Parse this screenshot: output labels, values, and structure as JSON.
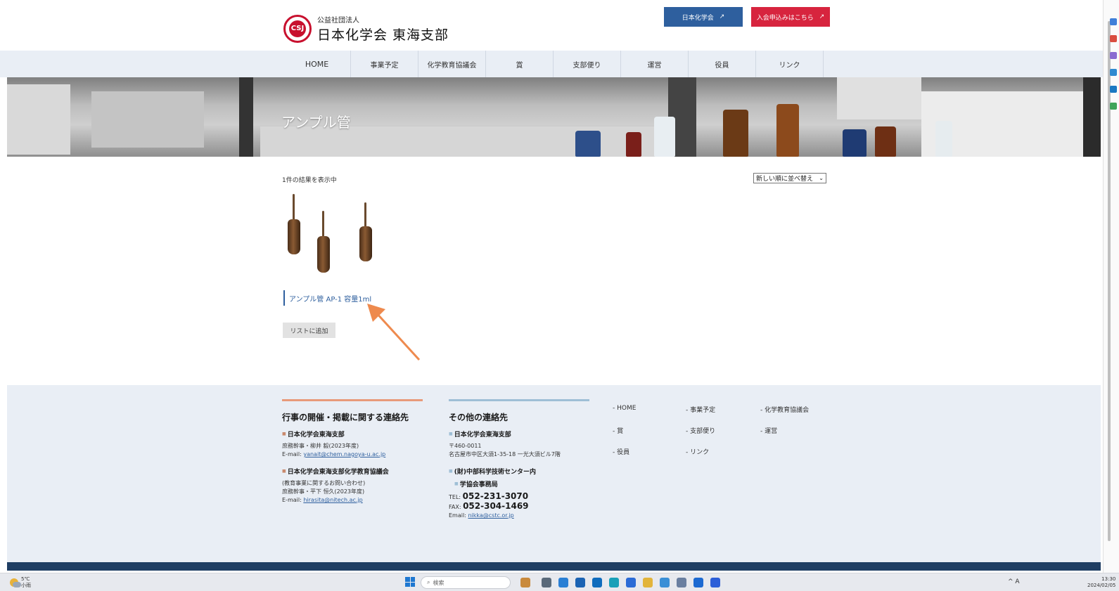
{
  "header": {
    "org_prefix": "公益社団法人",
    "org_name": "日本化学会 東海支部",
    "logo_mark": "CSJ",
    "btn_csj": "日本化学会",
    "btn_join": "入会申込みはこちら",
    "ext_icon": "external-link-icon"
  },
  "nav": {
    "items": [
      "HOME",
      "事業予定",
      "化学教育協議会",
      "賞",
      "支部便り",
      "運営",
      "役員",
      "リンク"
    ]
  },
  "hero": {
    "title": "アンプル管"
  },
  "shop": {
    "result_count": "1件の結果を表示中",
    "sort_label": "新しい順に並べ替え",
    "product_name": "アンプル管 AP-1 容量1ml",
    "add_to_list": "リストに追加"
  },
  "footer": {
    "col1": {
      "heading": "行事の開催・掲載に関する連絡先",
      "block1_title": "日本化学会東海支部",
      "block1_line1": "庶務幹事・柳井 毅(2023年度)",
      "block1_email_label": "E-mail: ",
      "block1_email": "yanait@chem.nagoya-u.ac.jp",
      "block2_title": "日本化学会東海支部化学教育協議会",
      "block2_line1": "(教育事業に関するお問い合わせ)",
      "block2_line2": "庶務幹事・平下 恒久(2023年度)",
      "block2_email_label": "E-mail: ",
      "block2_email": "hirasita@nitech.ac.jp"
    },
    "col2": {
      "heading": "その他の連絡先",
      "block1_title": "日本化学会東海支部",
      "block1_line1": "〒460-0011",
      "block1_line2": "名古屋市中区大須1-35-18 一光大須ビル7階",
      "block2_title_1": "(財)中部科学技術センター内",
      "block2_title_2": "学協会事務局",
      "tel_label": "TEL: ",
      "tel": "052-231-3070",
      "fax_label": "FAX: ",
      "fax": "052-304-1469",
      "email_label": "Email: ",
      "email": "nikka@cstc.or.jp"
    },
    "menu": [
      "- HOME",
      "- 事業予定",
      "- 化学教育協議会",
      "- 賞",
      "- 支部便り",
      "- 運営",
      "- 役員",
      "- リンク"
    ]
  },
  "taskbar": {
    "weather_temp": "5℃",
    "weather_desc": "小雨",
    "search_placeholder": "検索",
    "tray": "^ A",
    "time": "13:30",
    "date": "2024/02/05"
  },
  "colors": {
    "accent_blue": "#2e5f9e",
    "accent_red": "#d7243e",
    "nav_bg": "#e9eef5",
    "footer_bar": "#1f3e63"
  }
}
